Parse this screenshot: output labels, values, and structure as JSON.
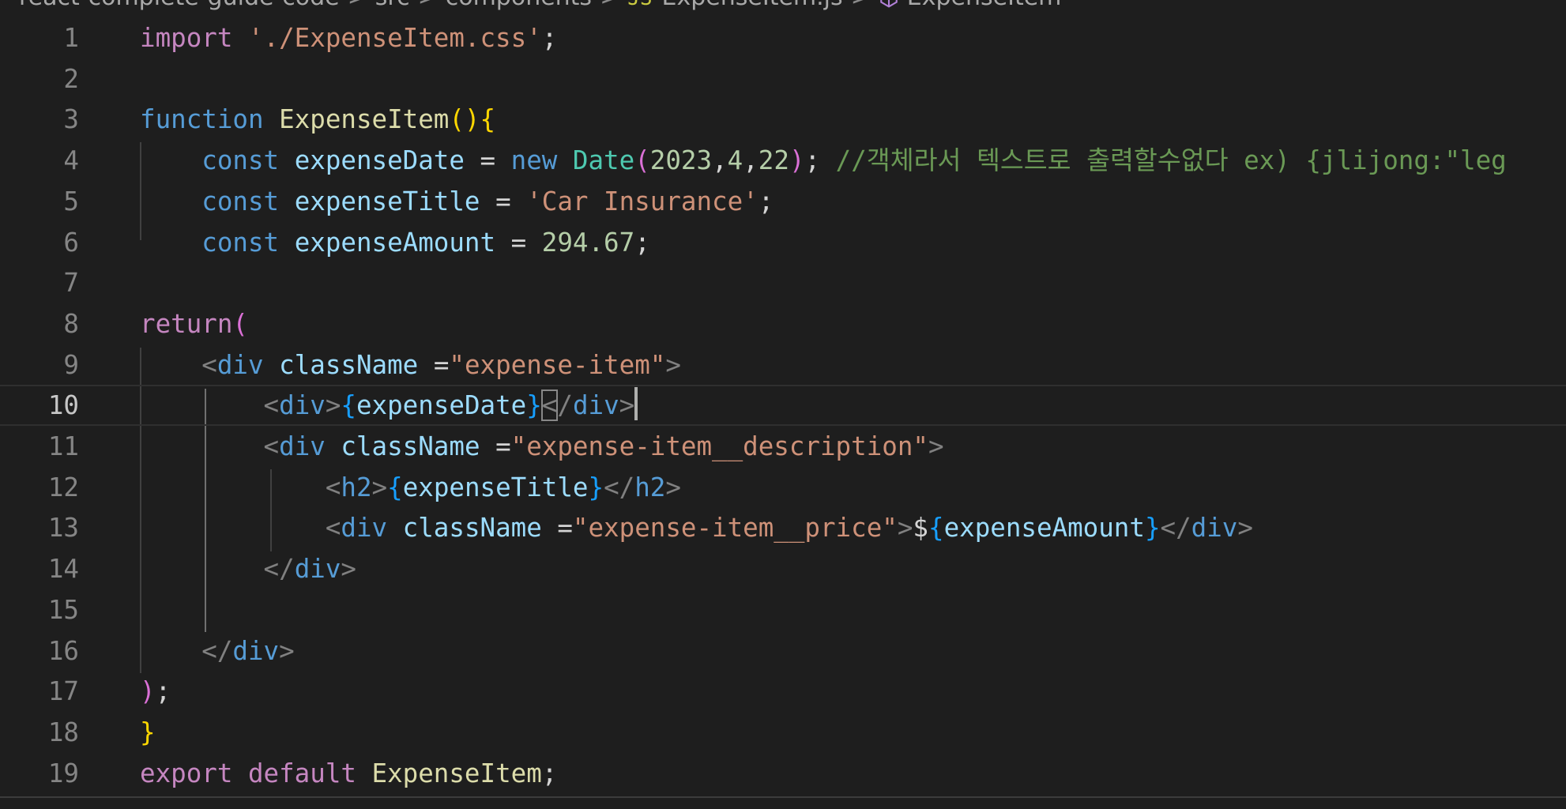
{
  "breadcrumb": {
    "items": [
      "react-complete-guide-code",
      "src",
      "components",
      "ExpenseItem.js",
      "ExpenseItem"
    ],
    "separator": ">"
  },
  "editor": {
    "language": "javascript",
    "current_line": 10,
    "lines": [
      {
        "n": "1",
        "tokens": [
          [
            "kw-ctrl",
            "import"
          ],
          [
            "txt",
            " "
          ],
          [
            "str",
            "'./ExpenseItem.css'"
          ],
          [
            "txt",
            ";"
          ]
        ]
      },
      {
        "n": "2",
        "tokens": []
      },
      {
        "n": "3",
        "tokens": [
          [
            "kw",
            "function"
          ],
          [
            "txt",
            " "
          ],
          [
            "fn",
            "ExpenseItem"
          ],
          [
            "br1",
            "()"
          ],
          [
            "br1",
            "{"
          ]
        ]
      },
      {
        "n": "4",
        "tokens": [
          [
            "txt",
            "    "
          ],
          [
            "kw",
            "const"
          ],
          [
            "txt",
            " "
          ],
          [
            "var",
            "expenseDate"
          ],
          [
            "txt",
            " = "
          ],
          [
            "kw",
            "new"
          ],
          [
            "txt",
            " "
          ],
          [
            "cls",
            "Date"
          ],
          [
            "br2",
            "("
          ],
          [
            "num",
            "2023"
          ],
          [
            "txt",
            ","
          ],
          [
            "num",
            "4"
          ],
          [
            "txt",
            ","
          ],
          [
            "num",
            "22"
          ],
          [
            "br2",
            ")"
          ],
          [
            "txt",
            "; "
          ],
          [
            "cmt",
            "//객체라서 텍스트로 출력할수없다 ex) {jlijong:\"leg"
          ]
        ]
      },
      {
        "n": "5",
        "tokens": [
          [
            "txt",
            "    "
          ],
          [
            "kw",
            "const"
          ],
          [
            "txt",
            " "
          ],
          [
            "var",
            "expenseTitle"
          ],
          [
            "txt",
            " = "
          ],
          [
            "str",
            "'Car Insurance'"
          ],
          [
            "txt",
            ";"
          ]
        ]
      },
      {
        "n": "6",
        "tokens": [
          [
            "txt",
            "    "
          ],
          [
            "kw",
            "const"
          ],
          [
            "txt",
            " "
          ],
          [
            "var",
            "expenseAmount"
          ],
          [
            "txt",
            " = "
          ],
          [
            "num",
            "294.67"
          ],
          [
            "txt",
            ";"
          ]
        ]
      },
      {
        "n": "7",
        "tokens": []
      },
      {
        "n": "8",
        "tokens": [
          [
            "kw-ctrl",
            "return"
          ],
          [
            "br2",
            "("
          ]
        ]
      },
      {
        "n": "9",
        "tokens": [
          [
            "txt",
            "    "
          ],
          [
            "tagp",
            "<"
          ],
          [
            "tag",
            "div"
          ],
          [
            "txt",
            " "
          ],
          [
            "attr",
            "className"
          ],
          [
            "txt",
            " ="
          ],
          [
            "str",
            "\"expense-item\""
          ],
          [
            "tagp",
            ">"
          ]
        ]
      },
      {
        "n": "10",
        "tokens": [
          [
            "txt",
            "        "
          ],
          [
            "tagp",
            "<"
          ],
          [
            "tag",
            "div"
          ],
          [
            "tagp",
            ">"
          ],
          [
            "br3",
            "{"
          ],
          [
            "var",
            "expenseDate"
          ],
          [
            "br3",
            "}"
          ],
          [
            "tagp",
            "<"
          ],
          [
            "tagp",
            "/"
          ],
          [
            "tag",
            "div"
          ],
          [
            "tagp",
            ">"
          ],
          [
            "cursor",
            ""
          ]
        ]
      },
      {
        "n": "11",
        "tokens": [
          [
            "txt",
            "        "
          ],
          [
            "tagp",
            "<"
          ],
          [
            "tag",
            "div"
          ],
          [
            "txt",
            " "
          ],
          [
            "attr",
            "className"
          ],
          [
            "txt",
            " ="
          ],
          [
            "str",
            "\"expense-item__description\""
          ],
          [
            "tagp",
            ">"
          ]
        ]
      },
      {
        "n": "12",
        "tokens": [
          [
            "txt",
            "            "
          ],
          [
            "tagp",
            "<"
          ],
          [
            "tag",
            "h2"
          ],
          [
            "tagp",
            ">"
          ],
          [
            "br3",
            "{"
          ],
          [
            "var",
            "expenseTitle"
          ],
          [
            "br3",
            "}"
          ],
          [
            "tagp",
            "</"
          ],
          [
            "tag",
            "h2"
          ],
          [
            "tagp",
            ">"
          ]
        ]
      },
      {
        "n": "13",
        "tokens": [
          [
            "txt",
            "            "
          ],
          [
            "tagp",
            "<"
          ],
          [
            "tag",
            "div"
          ],
          [
            "txt",
            " "
          ],
          [
            "attr",
            "className"
          ],
          [
            "txt",
            " ="
          ],
          [
            "str",
            "\"expense-item__price\""
          ],
          [
            "tagp",
            ">"
          ],
          [
            "txt",
            "$"
          ],
          [
            "br3",
            "{"
          ],
          [
            "var",
            "expenseAmount"
          ],
          [
            "br3",
            "}"
          ],
          [
            "tagp",
            "</"
          ],
          [
            "tag",
            "div"
          ],
          [
            "tagp",
            ">"
          ]
        ]
      },
      {
        "n": "14",
        "tokens": [
          [
            "txt",
            "        "
          ],
          [
            "tagp",
            "</"
          ],
          [
            "tag",
            "div"
          ],
          [
            "tagp",
            ">"
          ]
        ]
      },
      {
        "n": "15",
        "tokens": []
      },
      {
        "n": "16",
        "tokens": [
          [
            "txt",
            "    "
          ],
          [
            "tagp",
            "</"
          ],
          [
            "tag",
            "div"
          ],
          [
            "tagp",
            ">"
          ]
        ]
      },
      {
        "n": "17",
        "tokens": [
          [
            "br2",
            ")"
          ],
          [
            "txt",
            ";"
          ]
        ]
      },
      {
        "n": "18",
        "tokens": [
          [
            "br1",
            "}"
          ]
        ]
      },
      {
        "n": "19",
        "tokens": [
          [
            "kw-ctrl",
            "export"
          ],
          [
            "txt",
            " "
          ],
          [
            "kw-ctrl",
            "default"
          ],
          [
            "txt",
            " "
          ],
          [
            "fn",
            "ExpenseItem"
          ],
          [
            "txt",
            ";"
          ]
        ]
      }
    ]
  }
}
